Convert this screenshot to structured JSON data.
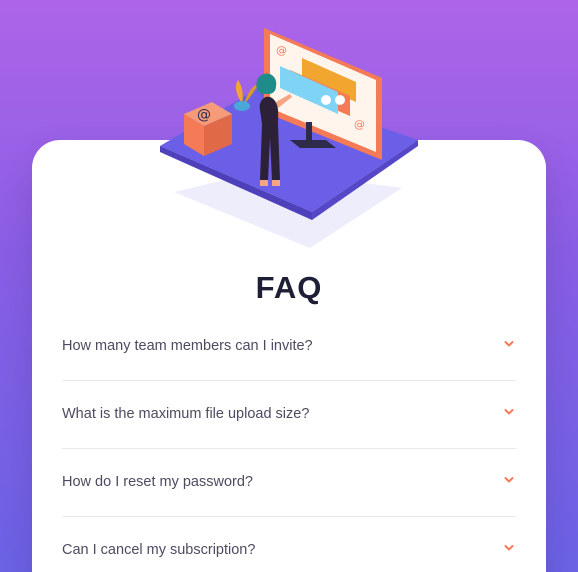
{
  "page": {
    "title": "FAQ",
    "accent_color": "#f47b56",
    "gradient_top": "#ad64e8",
    "gradient_bottom": "#6c63e6"
  },
  "illustration": {
    "icon": "at-sign-icon",
    "description_icons": [
      "monitor-icon",
      "chat-bubble-icon",
      "plant-icon",
      "box-icon"
    ]
  },
  "faq": {
    "items": [
      {
        "question": "How many team members can I invite?",
        "icon": "chevron-down-icon"
      },
      {
        "question": "What is the maximum file upload size?",
        "icon": "chevron-down-icon"
      },
      {
        "question": "How do I reset my password?",
        "icon": "chevron-down-icon"
      },
      {
        "question": "Can I cancel my subscription?",
        "icon": "chevron-down-icon"
      }
    ]
  }
}
